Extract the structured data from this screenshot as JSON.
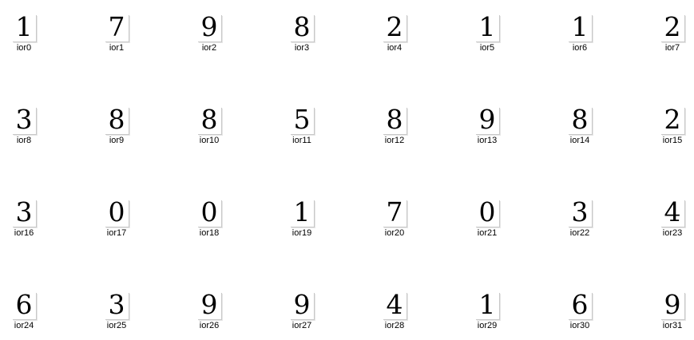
{
  "files": [
    {
      "name": "ior0",
      "digit": "1"
    },
    {
      "name": "ior1",
      "digit": "7"
    },
    {
      "name": "ior2",
      "digit": "9"
    },
    {
      "name": "ior3",
      "digit": "8"
    },
    {
      "name": "ior4",
      "digit": "2"
    },
    {
      "name": "ior5",
      "digit": "1"
    },
    {
      "name": "ior6",
      "digit": "1"
    },
    {
      "name": "ior7",
      "digit": "2"
    },
    {
      "name": "ior8",
      "digit": "3"
    },
    {
      "name": "ior9",
      "digit": "8"
    },
    {
      "name": "ior10",
      "digit": "8"
    },
    {
      "name": "ior11",
      "digit": "5"
    },
    {
      "name": "ior12",
      "digit": "8"
    },
    {
      "name": "ior13",
      "digit": "9"
    },
    {
      "name": "ior14",
      "digit": "8"
    },
    {
      "name": "ior15",
      "digit": "2"
    },
    {
      "name": "ior16",
      "digit": "3"
    },
    {
      "name": "ior17",
      "digit": "0"
    },
    {
      "name": "ior18",
      "digit": "0"
    },
    {
      "name": "ior19",
      "digit": "1"
    },
    {
      "name": "ior20",
      "digit": "7"
    },
    {
      "name": "ior21",
      "digit": "0"
    },
    {
      "name": "ior22",
      "digit": "3"
    },
    {
      "name": "ior23",
      "digit": "4"
    },
    {
      "name": "ior24",
      "digit": "6"
    },
    {
      "name": "ior25",
      "digit": "3"
    },
    {
      "name": "ior26",
      "digit": "9"
    },
    {
      "name": "ior27",
      "digit": "9"
    },
    {
      "name": "ior28",
      "digit": "4"
    },
    {
      "name": "ior29",
      "digit": "1"
    },
    {
      "name": "ior30",
      "digit": "6"
    },
    {
      "name": "ior31",
      "digit": "9"
    }
  ]
}
